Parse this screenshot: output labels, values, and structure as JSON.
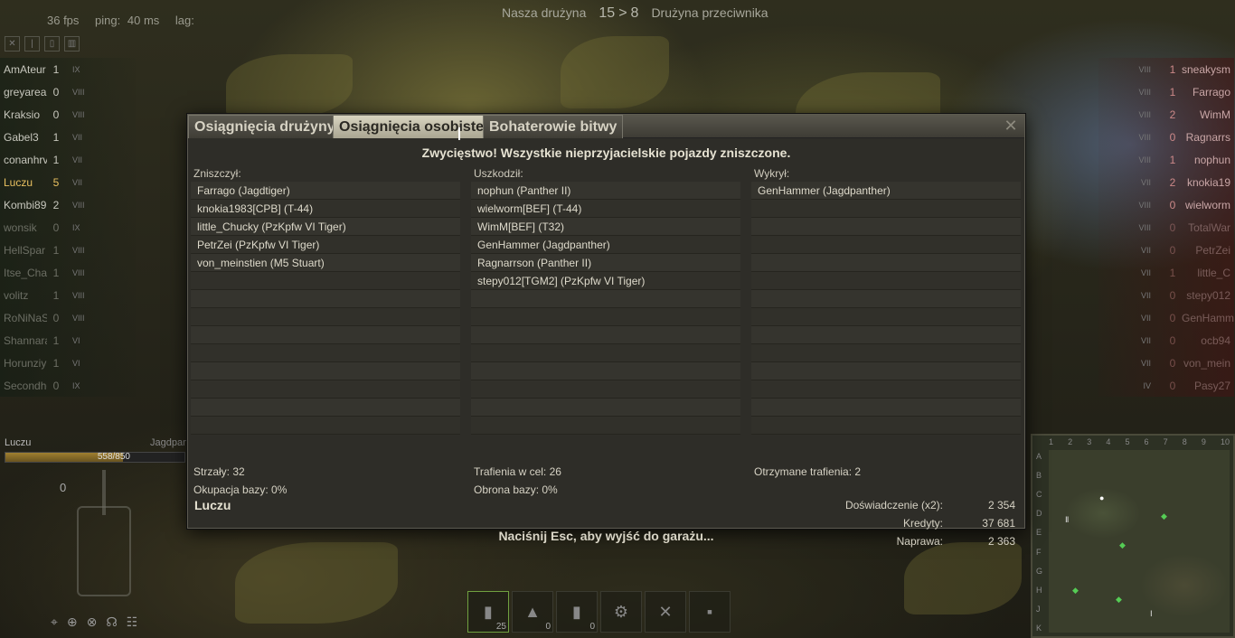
{
  "hud": {
    "fps_value": "36 fps",
    "ping_label": "ping:",
    "ping_value": "40 ms",
    "lag_label": "lag:",
    "our_team_label": "Nasza drużyna",
    "score_ours": "15",
    "score_sep": ">",
    "score_enemy": "8",
    "enemy_team_label": "Drużyna przeciwnika"
  },
  "team_left": [
    {
      "name": "AmAteur",
      "frags": "1",
      "tier": "IX"
    },
    {
      "name": "greyarea",
      "frags": "0",
      "tier": "VIII"
    },
    {
      "name": "Kraksio",
      "frags": "0",
      "tier": "VIII"
    },
    {
      "name": "Gabel3",
      "frags": "1",
      "tier": "VII"
    },
    {
      "name": "conanhrv",
      "frags": "1",
      "tier": "VII"
    },
    {
      "name": "Luczu",
      "frags": "5",
      "tier": "VII"
    },
    {
      "name": "Kombi89",
      "frags": "2",
      "tier": "VIII"
    },
    {
      "name": "wonsik",
      "frags": "0",
      "tier": "IX"
    },
    {
      "name": "HellSpar",
      "frags": "1",
      "tier": "VIII"
    },
    {
      "name": "Itse_Cha",
      "frags": "1",
      "tier": "VIII"
    },
    {
      "name": "volitz",
      "frags": "1",
      "tier": "VIII"
    },
    {
      "name": "RoNiNaS",
      "frags": "0",
      "tier": "VIII"
    },
    {
      "name": "Shannara",
      "frags": "1",
      "tier": "VI"
    },
    {
      "name": "Horunziy",
      "frags": "1",
      "tier": "VI"
    },
    {
      "name": "Secondho",
      "frags": "0",
      "tier": "IX"
    }
  ],
  "team_right": [
    {
      "name": "sneakysm",
      "frags": "1",
      "tier": "VIII"
    },
    {
      "name": "Farrago",
      "frags": "1",
      "tier": "VIII"
    },
    {
      "name": "WimM",
      "frags": "2",
      "tier": "VIII"
    },
    {
      "name": "Ragnarrs",
      "frags": "0",
      "tier": "VIII"
    },
    {
      "name": "nophun",
      "frags": "1",
      "tier": "VIII"
    },
    {
      "name": "knokia19",
      "frags": "2",
      "tier": "VII"
    },
    {
      "name": "wielworm",
      "frags": "0",
      "tier": "VIII"
    },
    {
      "name": "TotalWar",
      "frags": "0",
      "tier": "VIII"
    },
    {
      "name": "PetrZei",
      "frags": "0",
      "tier": "VII"
    },
    {
      "name": "little_C",
      "frags": "1",
      "tier": "VII"
    },
    {
      "name": "stepy012",
      "frags": "0",
      "tier": "VII"
    },
    {
      "name": "GenHamme",
      "frags": "0",
      "tier": "VII"
    },
    {
      "name": "ocb94",
      "frags": "0",
      "tier": "VII"
    },
    {
      "name": "von_mein",
      "frags": "0",
      "tier": "VII"
    },
    {
      "name": "Pasy27",
      "frags": "0",
      "tier": "IV"
    }
  ],
  "own_vehicle": {
    "player": "Luczu",
    "tank": "Jagdpan",
    "hp_text": "558/850",
    "hp_fraction": 0.656,
    "speed": "0"
  },
  "consumables": [
    {
      "icon": "shell-icon",
      "glyph": "▮",
      "count": "25",
      "active": true
    },
    {
      "icon": "shell-icon-2",
      "glyph": "▲",
      "count": "0",
      "active": false
    },
    {
      "icon": "shell-icon-3",
      "glyph": "▮",
      "count": "0",
      "active": false
    },
    {
      "icon": "repair-kit-icon",
      "glyph": "⚙",
      "count": "",
      "active": false
    },
    {
      "icon": "tools-icon",
      "glyph": "✕",
      "count": "",
      "active": false
    },
    {
      "icon": "extinguisher-icon",
      "glyph": "▪",
      "count": "",
      "active": false
    }
  ],
  "minimap": {
    "cols": [
      "1",
      "2",
      "3",
      "4",
      "5",
      "6",
      "7",
      "8",
      "9",
      "10"
    ],
    "rows": [
      "A",
      "B",
      "C",
      "D",
      "E",
      "F",
      "G",
      "H",
      "J",
      "K"
    ]
  },
  "dialog": {
    "tabs": [
      "Osiągnięcia drużyny",
      "Osiągnięcia osobiste",
      "Bohaterowie bitwy"
    ],
    "active_tab": 1,
    "close_glyph": "✕",
    "headline": "Zwycięstwo! Wszystkie nieprzyjacielskie pojazdy zniszczone.",
    "destroyed_title": "Zniszczył:",
    "destroyed": [
      "Farrago (Jagdtiger)",
      "knokia1983[CPB] (T-44)",
      "little_Chucky (PzKpfw VI Tiger)",
      "PetrZei (PzKpfw VI Tiger)",
      "von_meinstien (M5 Stuart)"
    ],
    "damaged_title": "Uszkodził:",
    "damaged": [
      "nophun (Panther II)",
      "wielworm[BEF] (T-44)",
      "WimM[BEF] (T32)",
      "GenHammer (Jagdpanther)",
      "Ragnarrson (Panther II)",
      "stepy012[TGM2] (PzKpfw VI Tiger)"
    ],
    "spotted_title": "Wykrył:",
    "spotted": [
      "GenHammer (Jagdpanther)"
    ],
    "shots": "Strzały: 32",
    "hits": "Trafienia w cel: 26",
    "hits_received": "Otrzymane trafienia: 2",
    "base_capture": "Okupacja bazy: 0%",
    "base_defense": "Obrona bazy: 0%",
    "player_name": "Luczu",
    "rewards": [
      {
        "label": "Doświadczenie (x2):",
        "value": "2 354"
      },
      {
        "label": "Kredyty:",
        "value": "37 681"
      },
      {
        "label": "Naprawa:",
        "value": "2 363"
      }
    ],
    "footer": "Naciśnij Esc, aby wyjść do garażu..."
  }
}
